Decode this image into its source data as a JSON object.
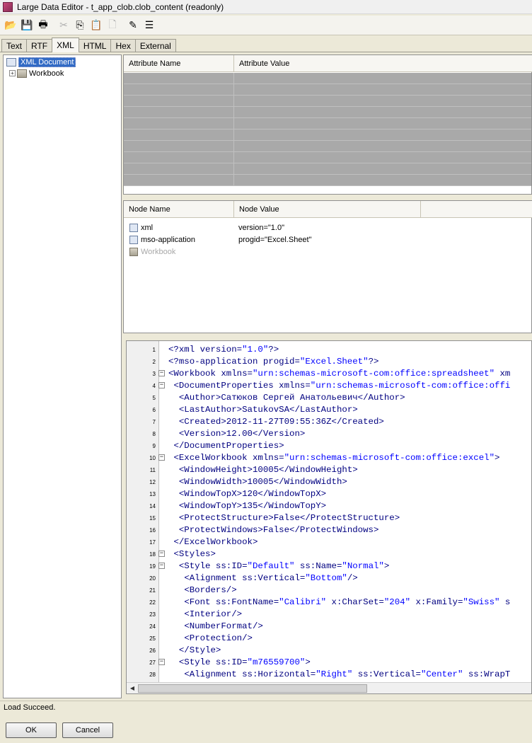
{
  "window": {
    "title": "Large Data Editor - t_app_clob.clob_content (readonly)"
  },
  "toolbar": {
    "buttons": [
      {
        "icon": "open-folder-icon",
        "glyph": "📂",
        "disabled": true
      },
      {
        "icon": "save-icon",
        "glyph": "💾",
        "disabled": false
      },
      {
        "icon": "print-icon",
        "glyph": "🖶",
        "disabled": false
      },
      {
        "icon": "cut-icon",
        "glyph": "✂",
        "disabled": true
      },
      {
        "icon": "copy-icon",
        "glyph": "⎘",
        "disabled": false
      },
      {
        "icon": "paste-icon",
        "glyph": "📋",
        "disabled": true
      },
      {
        "icon": "clear-icon",
        "glyph": "🗋",
        "disabled": true
      },
      {
        "icon": "edit-icon",
        "glyph": "✎",
        "disabled": false
      },
      {
        "icon": "wrap-icon",
        "glyph": "☰",
        "disabled": false
      }
    ]
  },
  "tabs": [
    "Text",
    "RTF",
    "XML",
    "HTML",
    "Hex",
    "External"
  ],
  "active_tab": "XML",
  "tree": {
    "root": "XML Document",
    "child": "Workbook"
  },
  "attributes": {
    "headers": [
      "Attribute Name",
      "Attribute Value"
    ]
  },
  "nodes": {
    "headers": [
      "Node Name",
      "Node Value"
    ],
    "rows": [
      {
        "name": "xml",
        "value": "version=\"1.0\"",
        "dim": false
      },
      {
        "name": "mso-application",
        "value": "progid=\"Excel.Sheet\"",
        "dim": false
      },
      {
        "name": "Workbook",
        "value": "",
        "dim": true
      }
    ]
  },
  "code": {
    "lines": [
      {
        "n": "1",
        "indent": 0,
        "fold": "",
        "text": "<?xml version=\"1.0\"?>"
      },
      {
        "n": "2",
        "indent": 0,
        "fold": "",
        "text": "<?mso-application progid=\"Excel.Sheet\"?>"
      },
      {
        "n": "3",
        "indent": 0,
        "fold": "−",
        "text": "<Workbook xmlns=\"urn:schemas-microsoft-com:office:spreadsheet\" xm"
      },
      {
        "n": "4",
        "indent": 1,
        "fold": "−",
        "text": "<DocumentProperties xmlns=\"urn:schemas-microsoft-com:office:offi"
      },
      {
        "n": "5",
        "indent": 2,
        "fold": "",
        "text": "<Author>Сатюков Сергей Анатольевич</Author>"
      },
      {
        "n": "6",
        "indent": 2,
        "fold": "",
        "text": "<LastAuthor>SatukovSA</LastAuthor>"
      },
      {
        "n": "7",
        "indent": 2,
        "fold": "",
        "text": "<Created>2012-11-27T09:55:36Z</Created>"
      },
      {
        "n": "8",
        "indent": 2,
        "fold": "",
        "text": "<Version>12.00</Version>"
      },
      {
        "n": "9",
        "indent": 1,
        "fold": "",
        "text": "</DocumentProperties>"
      },
      {
        "n": "10",
        "indent": 1,
        "fold": "−",
        "text": "<ExcelWorkbook xmlns=\"urn:schemas-microsoft-com:office:excel\">"
      },
      {
        "n": "11",
        "indent": 2,
        "fold": "",
        "text": "<WindowHeight>10005</WindowHeight>"
      },
      {
        "n": "12",
        "indent": 2,
        "fold": "",
        "text": "<WindowWidth>10005</WindowWidth>"
      },
      {
        "n": "13",
        "indent": 2,
        "fold": "",
        "text": "<WindowTopX>120</WindowTopX>"
      },
      {
        "n": "14",
        "indent": 2,
        "fold": "",
        "text": "<WindowTopY>135</WindowTopY>"
      },
      {
        "n": "15",
        "indent": 2,
        "fold": "",
        "text": "<ProtectStructure>False</ProtectStructure>"
      },
      {
        "n": "16",
        "indent": 2,
        "fold": "",
        "text": "<ProtectWindows>False</ProtectWindows>"
      },
      {
        "n": "17",
        "indent": 1,
        "fold": "",
        "text": "</ExcelWorkbook>"
      },
      {
        "n": "18",
        "indent": 1,
        "fold": "−",
        "text": "<Styles>"
      },
      {
        "n": "19",
        "indent": 2,
        "fold": "−",
        "text": "<Style ss:ID=\"Default\" ss:Name=\"Normal\">"
      },
      {
        "n": "20",
        "indent": 3,
        "fold": "",
        "text": "<Alignment ss:Vertical=\"Bottom\"/>"
      },
      {
        "n": "21",
        "indent": 3,
        "fold": "",
        "text": "<Borders/>"
      },
      {
        "n": "22",
        "indent": 3,
        "fold": "",
        "text": "<Font ss:FontName=\"Calibri\" x:CharSet=\"204\" x:Family=\"Swiss\" s"
      },
      {
        "n": "23",
        "indent": 3,
        "fold": "",
        "text": "<Interior/>"
      },
      {
        "n": "24",
        "indent": 3,
        "fold": "",
        "text": "<NumberFormat/>"
      },
      {
        "n": "25",
        "indent": 3,
        "fold": "",
        "text": "<Protection/>"
      },
      {
        "n": "26",
        "indent": 2,
        "fold": "",
        "text": "</Style>"
      },
      {
        "n": "27",
        "indent": 2,
        "fold": "−",
        "text": "<Style ss:ID=\"m76559700\">"
      },
      {
        "n": "28",
        "indent": 3,
        "fold": "",
        "text": "<Alignment ss:Horizontal=\"Right\" ss:Vertical=\"Center\" ss:WrapT"
      }
    ]
  },
  "status": {
    "text": "Load Succeed."
  },
  "dialog": {
    "ok_label": "OK",
    "cancel_label": "Cancel"
  },
  "colors": {
    "tag": "#000080",
    "string": "#0000ff",
    "selection": "#316ac5",
    "attr_row_fill": "#a9a9a9"
  }
}
